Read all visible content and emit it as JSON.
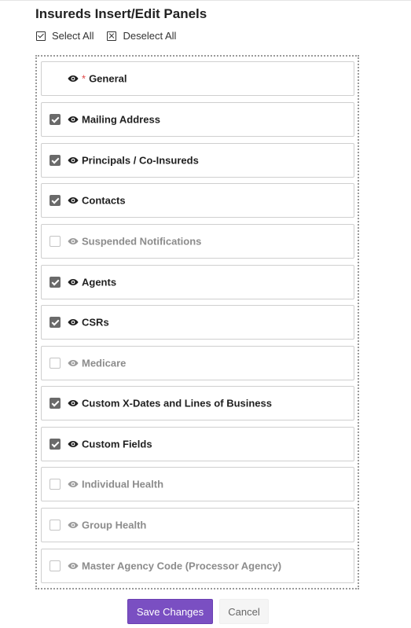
{
  "title": "Insureds Insert/Edit Panels",
  "select_all_label": "Select All",
  "deselect_all_label": "Deselect All",
  "panels": [
    {
      "label": "General",
      "checked": null,
      "required": true,
      "required_mark": "*"
    },
    {
      "label": "Mailing Address",
      "checked": true
    },
    {
      "label": "Principals / Co-Insureds",
      "checked": true
    },
    {
      "label": "Contacts",
      "checked": true
    },
    {
      "label": "Suspended Notifications",
      "checked": false
    },
    {
      "label": "Agents",
      "checked": true
    },
    {
      "label": "CSRs",
      "checked": true
    },
    {
      "label": "Medicare",
      "checked": false
    },
    {
      "label": "Custom X-Dates and Lines of Business",
      "checked": true
    },
    {
      "label": "Custom Fields",
      "checked": true
    },
    {
      "label": "Individual Health",
      "checked": false
    },
    {
      "label": "Group Health",
      "checked": false
    },
    {
      "label": "Master Agency Code (Processor Agency)",
      "checked": false
    }
  ],
  "buttons": {
    "save_label": "Save Changes",
    "cancel_label": "Cancel"
  },
  "colors": {
    "accent": "#7a4fc2",
    "required": "#e04848",
    "checked_box": "#6a6a6a",
    "disabled_text": "#8c8c8c"
  }
}
